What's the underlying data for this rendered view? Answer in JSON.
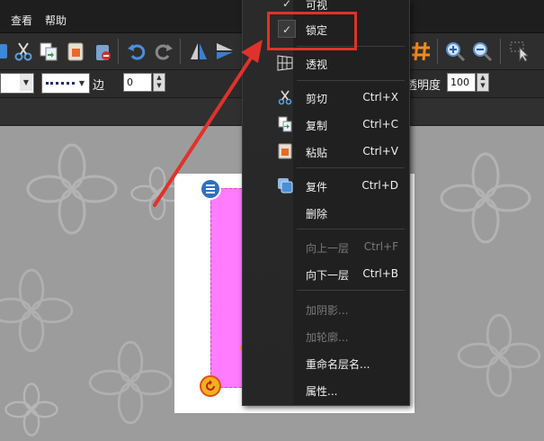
{
  "menubar": {
    "items": [
      "查看",
      "帮助"
    ]
  },
  "toolbar": {
    "icons": [
      "scissors-icon",
      "copy-icon",
      "paste-icon",
      "clear-icon",
      "undo-icon",
      "redo-icon",
      "flip-vertical-icon",
      "flip-horizontal-icon"
    ],
    "right_icons": [
      "grid-hash-icon",
      "zoom-in-icon",
      "zoom-out-icon",
      "select-tool-icon"
    ]
  },
  "properties": {
    "border_label": "边",
    "border_value": "0",
    "opacity_label": "透明度",
    "opacity_value": "100"
  },
  "context_menu": {
    "items": [
      {
        "label": "可视",
        "shortcut": "",
        "checked": true,
        "enabled": true
      },
      {
        "label": "锁定",
        "shortcut": "",
        "checked": true,
        "enabled": true,
        "highlighted": true
      },
      {
        "label": "透视",
        "shortcut": "",
        "icon": "perspective-grid-icon",
        "enabled": true
      },
      {
        "label": "剪切",
        "shortcut": "Ctrl+X",
        "icon": "scissors-icon",
        "enabled": true
      },
      {
        "label": "复制",
        "shortcut": "Ctrl+C",
        "icon": "copy-icon",
        "enabled": true
      },
      {
        "label": "粘贴",
        "shortcut": "Ctrl+V",
        "icon": "paste-icon",
        "enabled": true
      },
      {
        "label": "复件",
        "shortcut": "Ctrl+D",
        "icon": "duplicate-icon",
        "enabled": true
      },
      {
        "label": "删除",
        "shortcut": "",
        "enabled": true
      },
      {
        "label": "向上一层",
        "shortcut": "Ctrl+F",
        "enabled": false
      },
      {
        "label": "向下一层",
        "shortcut": "Ctrl+B",
        "enabled": true
      },
      {
        "label": "加阴影...",
        "shortcut": "",
        "enabled": false
      },
      {
        "label": "加轮廓...",
        "shortcut": "",
        "enabled": false
      },
      {
        "label": "重命名层名...",
        "shortcut": "",
        "enabled": true
      },
      {
        "label": "属性...",
        "shortcut": "",
        "enabled": true
      }
    ]
  },
  "colors": {
    "highlight_box": "#e0322b",
    "annotation_arrow": "#e0322b",
    "shape_fill": "#ff7bff"
  }
}
